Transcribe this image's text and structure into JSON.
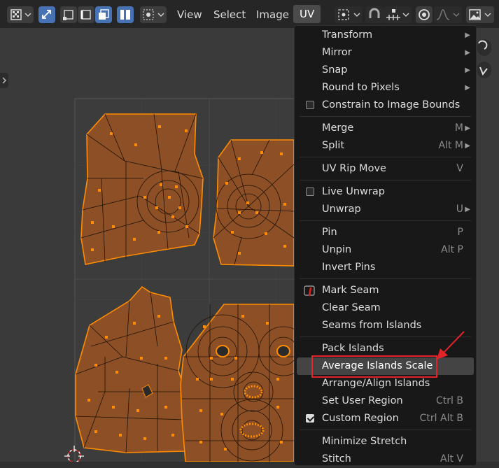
{
  "header": {
    "menus": [
      "View",
      "Select",
      "Image",
      "UV"
    ],
    "active_menu": "UV"
  },
  "uv_menu": {
    "items": [
      {
        "label": "Transform",
        "submenu": true
      },
      {
        "label": "Mirror",
        "submenu": true
      },
      {
        "label": "Snap",
        "submenu": true
      },
      {
        "label": "Round to Pixels",
        "submenu": true
      },
      {
        "label": "Constrain to Image Bounds",
        "checkbox": false
      },
      {
        "label": "Merge",
        "shortcut": "M",
        "submenu": true
      },
      {
        "label": "Split",
        "shortcut": "Alt M",
        "submenu": true
      },
      {
        "label": "UV Rip Move",
        "shortcut": "V"
      },
      {
        "label": "Live Unwrap",
        "checkbox": false
      },
      {
        "label": "Unwrap",
        "shortcut": "U",
        "submenu": true
      },
      {
        "label": "Pin",
        "shortcut": "P"
      },
      {
        "label": "Unpin",
        "shortcut": "Alt P"
      },
      {
        "label": "Invert Pins"
      },
      {
        "label": "Mark Seam"
      },
      {
        "label": "Clear Seam"
      },
      {
        "label": "Seams from Islands"
      },
      {
        "label": "Pack Islands"
      },
      {
        "label": "Average Islands Scale",
        "highlighted": true
      },
      {
        "label": "Arrange/Align Islands"
      },
      {
        "label": "Set User Region",
        "shortcut": "Ctrl B"
      },
      {
        "label": "Custom Region",
        "shortcut": "Ctrl Alt B",
        "checkbox": true
      },
      {
        "label": "Minimize Stretch"
      },
      {
        "label": "Stitch",
        "shortcut": "Alt V"
      }
    ]
  },
  "colors": {
    "accent_blue": "#4772b3",
    "uv_island_fill": "#8c4f26",
    "uv_edge": "#ff8c00",
    "annotation_red": "#e0242a"
  }
}
